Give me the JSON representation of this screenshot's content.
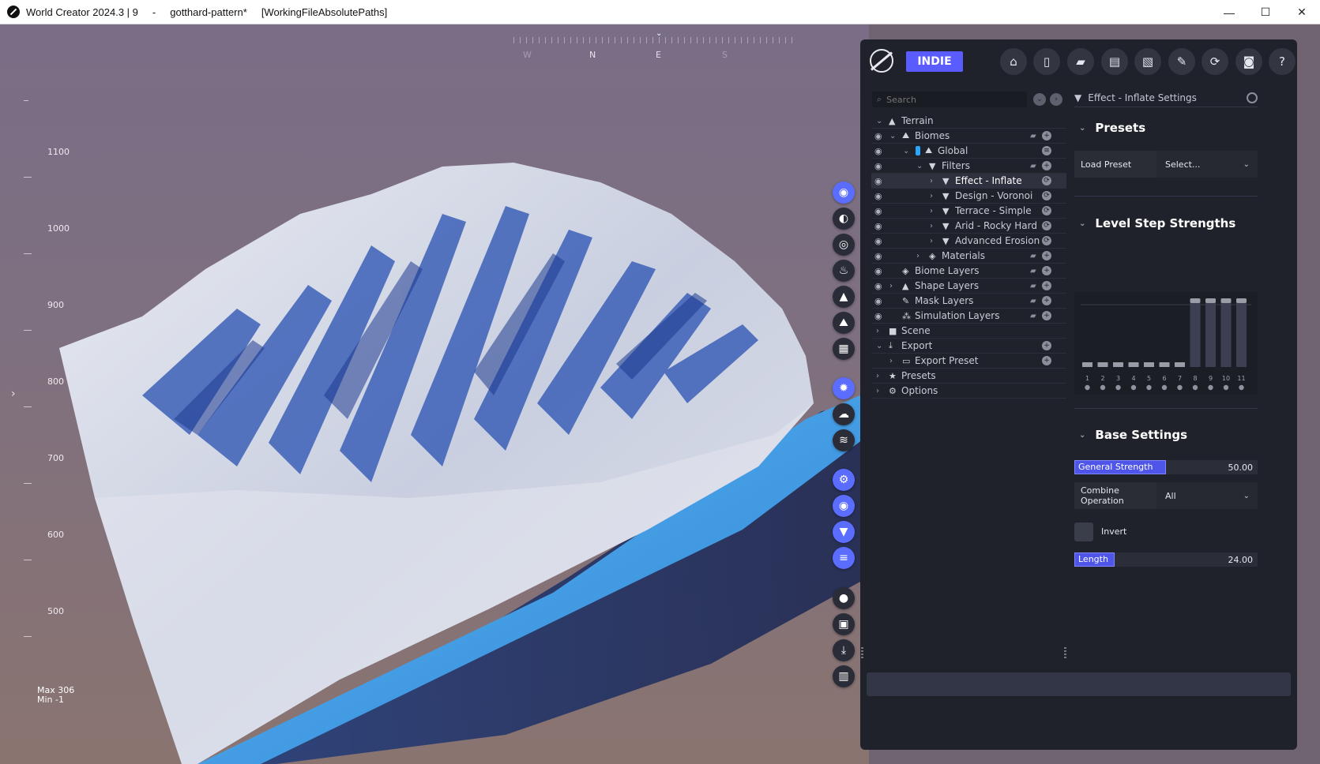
{
  "window": {
    "app_title": "World Creator 2024.3 | 9",
    "separator": "-",
    "file": "gotthard-pattern*",
    "mode": "[WorkingFileAbsolutePaths]",
    "controls": {
      "minimize": "—",
      "maximize": "☐",
      "close": "✕"
    }
  },
  "viewport": {
    "compass": [
      "W",
      "N",
      "E",
      "S"
    ],
    "heights": [
      "1100",
      "1000",
      "900",
      "800",
      "700",
      "600",
      "500"
    ],
    "max_label": "Max 306",
    "min_label": "Min -1"
  },
  "toolbar": {
    "edition": "INDIE",
    "buttons": [
      "home-icon",
      "new-file-icon",
      "open-folder-icon",
      "save-icon",
      "save-as-icon",
      "export-icon",
      "refresh-icon",
      "camera-icon",
      "help-icon"
    ]
  },
  "tree": {
    "search_placeholder": "Search",
    "rows": [
      {
        "label": "Terrain",
        "icon": "▲",
        "level": 0,
        "expanded": true,
        "eye": false
      },
      {
        "label": "Biomes",
        "icon": "⛰",
        "level": 1,
        "expanded": true,
        "eye": true,
        "folder": true,
        "add": true
      },
      {
        "label": "Global",
        "icon": "⛰",
        "level": 2,
        "expanded": true,
        "eye": true,
        "chip": true,
        "layers": true
      },
      {
        "label": "Filters",
        "icon": "▼",
        "level": 3,
        "expanded": true,
        "eye": true,
        "folder": true,
        "add": true
      },
      {
        "label": "Effect - Inflate",
        "icon": "▼",
        "level": 4,
        "expanded": false,
        "eye": true,
        "sync": true,
        "selected": true
      },
      {
        "label": "Design - Voronoi",
        "icon": "▼",
        "level": 4,
        "expanded": false,
        "eye": true,
        "sync": true
      },
      {
        "label": "Terrace - Simple",
        "icon": "▼",
        "level": 4,
        "expanded": false,
        "eye": true,
        "sync": true
      },
      {
        "label": "Arid - Rocky Hard",
        "icon": "▼",
        "level": 4,
        "expanded": false,
        "eye": true,
        "sync": true
      },
      {
        "label": "Advanced Erosion - Sc",
        "icon": "▼",
        "level": 4,
        "expanded": false,
        "eye": true,
        "sync": true
      },
      {
        "label": "Materials",
        "icon": "◈",
        "level": 3,
        "expanded": false,
        "eye": true,
        "folder": true,
        "add": true
      },
      {
        "label": "Biome Layers",
        "icon": "◈",
        "level": 1,
        "expanded": null,
        "eye": true,
        "folder": true,
        "add": true
      },
      {
        "label": "Shape Layers",
        "icon": "▲",
        "level": 1,
        "expanded": false,
        "eye": true,
        "folder": true,
        "add": true
      },
      {
        "label": "Mask Layers",
        "icon": "✎",
        "level": 1,
        "expanded": null,
        "eye": true,
        "folder": true,
        "add": true
      },
      {
        "label": "Simulation Layers",
        "icon": "⁂",
        "level": 1,
        "expanded": null,
        "eye": true,
        "folder": true,
        "add": true
      },
      {
        "label": "Scene",
        "icon": "■",
        "level": 0,
        "expanded": false,
        "eye": false
      },
      {
        "label": "Export",
        "icon": "⤓",
        "level": 0,
        "expanded": true,
        "eye": false,
        "add": true
      },
      {
        "label": "Export Preset",
        "icon": "▭",
        "level": 1,
        "expanded": false,
        "eye": false,
        "add": true
      },
      {
        "label": "Presets",
        "icon": "★",
        "level": 0,
        "expanded": false,
        "eye": false
      },
      {
        "label": "Options",
        "icon": "⚙",
        "level": 0,
        "expanded": false,
        "eye": false
      }
    ]
  },
  "settings": {
    "header": "Effect - Inflate Settings",
    "presets": {
      "title": "Presets",
      "load_label": "Load Preset",
      "load_value": "Select..."
    },
    "level_steps": {
      "title": "Level Step Strengths",
      "steps": [
        "1",
        "2",
        "3",
        "4",
        "5",
        "6",
        "7",
        "8",
        "9",
        "10",
        "11"
      ],
      "values": [
        0.0,
        0.0,
        0.0,
        0.0,
        0.0,
        0.0,
        0.0,
        1.0,
        1.0,
        1.0,
        1.0
      ]
    },
    "base": {
      "title": "Base Settings",
      "general_strength_label": "General Strength",
      "general_strength_value": "50.00",
      "general_strength_fraction": 0.5,
      "combine_label": "Combine Operation",
      "combine_value": "All",
      "invert_label": "Invert",
      "length_label": "Length",
      "length_value": "24.00",
      "length_fraction": 0.22
    }
  },
  "colors": {
    "accent": "#5b5cff",
    "panel": "#20222b",
    "water": "#3aa0e8",
    "snow": "#e8eaf0",
    "rock_shadow": "#2a4fa8"
  }
}
